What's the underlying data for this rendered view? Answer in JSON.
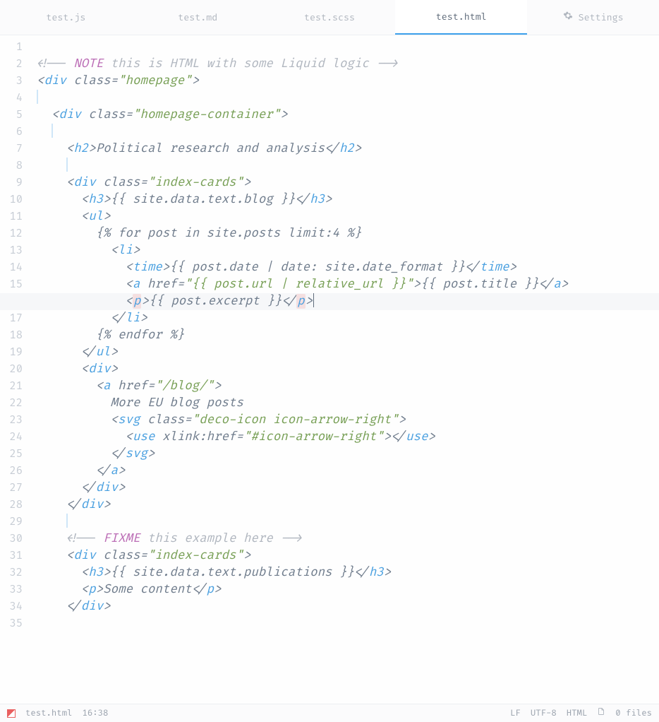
{
  "tabs": [
    {
      "label": "test.js",
      "active": false
    },
    {
      "label": "test.md",
      "active": false
    },
    {
      "label": "test.scss",
      "active": false
    },
    {
      "label": "test.html",
      "active": true
    },
    {
      "label": "Settings",
      "active": false,
      "icon": "gear"
    }
  ],
  "gutter": {
    "total": 35,
    "active_line": 16
  },
  "code_lines": [
    {
      "n": 1,
      "ind": 0,
      "tokens": []
    },
    {
      "n": 2,
      "ind": 0,
      "tokens": [
        [
          "cmnt",
          "<!-- "
        ],
        [
          "kw",
          "NOTE"
        ],
        [
          "cmnt",
          " this is HTML with some Liquid logic -->"
        ]
      ]
    },
    {
      "n": 3,
      "ind": 0,
      "tokens": [
        [
          "brkt",
          "<"
        ],
        [
          "tag",
          "div"
        ],
        [
          "txt",
          " "
        ],
        [
          "attr",
          "class"
        ],
        [
          "brkt",
          "="
        ],
        [
          "str",
          "\"homepage\""
        ],
        [
          "brkt",
          ">"
        ]
      ]
    },
    {
      "n": 4,
      "ind": 0,
      "tokens": [
        [
          "ig",
          ""
        ]
      ]
    },
    {
      "n": 5,
      "ind": 1,
      "tokens": [
        [
          "brkt",
          "<"
        ],
        [
          "tag",
          "div"
        ],
        [
          "txt",
          " "
        ],
        [
          "attr",
          "class"
        ],
        [
          "brkt",
          "="
        ],
        [
          "str",
          "\"homepage-container\""
        ],
        [
          "brkt",
          ">"
        ]
      ]
    },
    {
      "n": 6,
      "ind": 1,
      "tokens": [
        [
          "ig",
          ""
        ]
      ]
    },
    {
      "n": 7,
      "ind": 2,
      "tokens": [
        [
          "brkt",
          "<"
        ],
        [
          "tag",
          "h2"
        ],
        [
          "brkt",
          ">"
        ],
        [
          "txt",
          "Political research and analysis"
        ],
        [
          "brkt",
          "</"
        ],
        [
          "tag",
          "h2"
        ],
        [
          "brkt",
          ">"
        ]
      ]
    },
    {
      "n": 8,
      "ind": 2,
      "tokens": [
        [
          "ig",
          ""
        ]
      ]
    },
    {
      "n": 9,
      "ind": 2,
      "tokens": [
        [
          "brkt",
          "<"
        ],
        [
          "tag",
          "div"
        ],
        [
          "txt",
          " "
        ],
        [
          "attr",
          "class"
        ],
        [
          "brkt",
          "="
        ],
        [
          "str",
          "\"index-cards\""
        ],
        [
          "brkt",
          ">"
        ]
      ]
    },
    {
      "n": 10,
      "ind": 3,
      "tokens": [
        [
          "brkt",
          "<"
        ],
        [
          "tag",
          "h3"
        ],
        [
          "brkt",
          ">"
        ],
        [
          "liq",
          "{{ site.data.text.blog }}"
        ],
        [
          "brkt",
          "</"
        ],
        [
          "tag",
          "h3"
        ],
        [
          "brkt",
          ">"
        ]
      ]
    },
    {
      "n": 11,
      "ind": 3,
      "tokens": [
        [
          "brkt",
          "<"
        ],
        [
          "tag",
          "ul"
        ],
        [
          "brkt",
          ">"
        ]
      ]
    },
    {
      "n": 12,
      "ind": 4,
      "tokens": [
        [
          "liq",
          "{% for post in site.posts limit:4 %}"
        ]
      ]
    },
    {
      "n": 13,
      "ind": 5,
      "tokens": [
        [
          "brkt",
          "<"
        ],
        [
          "tag",
          "li"
        ],
        [
          "brkt",
          ">"
        ]
      ]
    },
    {
      "n": 14,
      "ind": 6,
      "tokens": [
        [
          "brkt",
          "<"
        ],
        [
          "tag",
          "time"
        ],
        [
          "brkt",
          ">"
        ],
        [
          "liq",
          "{{ post.date | date: site.date_format }}"
        ],
        [
          "brkt",
          "</"
        ],
        [
          "tag",
          "time"
        ],
        [
          "brkt",
          ">"
        ]
      ]
    },
    {
      "n": 15,
      "ind": 6,
      "tokens": [
        [
          "brkt",
          "<"
        ],
        [
          "tag",
          "a"
        ],
        [
          "txt",
          " "
        ],
        [
          "attr",
          "href"
        ],
        [
          "brkt",
          "="
        ],
        [
          "str",
          "\"{{ post.url | relative_url }}\""
        ],
        [
          "brkt",
          ">"
        ],
        [
          "liq",
          "{{ post.title }}"
        ],
        [
          "brkt",
          "</"
        ],
        [
          "tag",
          "a"
        ],
        [
          "brkt",
          ">"
        ]
      ]
    },
    {
      "n": 16,
      "ind": 6,
      "hl": true,
      "tokens": [
        [
          "brkt",
          "<"
        ],
        [
          "tag mark",
          "p"
        ],
        [
          "brkt",
          ">"
        ],
        [
          "liq",
          "{{ post.excerpt }}"
        ],
        [
          "brkt",
          "</"
        ],
        [
          "tag mark",
          "p"
        ],
        [
          "brkt",
          ">"
        ],
        [
          "cursor",
          ""
        ]
      ]
    },
    {
      "n": 17,
      "ind": 5,
      "tokens": [
        [
          "brkt",
          "</"
        ],
        [
          "tag",
          "li"
        ],
        [
          "brkt",
          ">"
        ]
      ]
    },
    {
      "n": 18,
      "ind": 4,
      "tokens": [
        [
          "liq",
          "{% endfor %}"
        ]
      ]
    },
    {
      "n": 19,
      "ind": 3,
      "tokens": [
        [
          "brkt",
          "</"
        ],
        [
          "tag",
          "ul"
        ],
        [
          "brkt",
          ">"
        ]
      ]
    },
    {
      "n": 20,
      "ind": 3,
      "tokens": [
        [
          "brkt",
          "<"
        ],
        [
          "tag",
          "div"
        ],
        [
          "brkt",
          ">"
        ]
      ]
    },
    {
      "n": 21,
      "ind": 4,
      "tokens": [
        [
          "brkt",
          "<"
        ],
        [
          "tag",
          "a"
        ],
        [
          "txt",
          " "
        ],
        [
          "attr",
          "href"
        ],
        [
          "brkt",
          "="
        ],
        [
          "str",
          "\"/blog/\""
        ],
        [
          "brkt",
          ">"
        ]
      ]
    },
    {
      "n": 22,
      "ind": 5,
      "tokens": [
        [
          "txt",
          "More EU blog posts"
        ]
      ]
    },
    {
      "n": 23,
      "ind": 5,
      "tokens": [
        [
          "brkt",
          "<"
        ],
        [
          "tag",
          "svg"
        ],
        [
          "txt",
          " "
        ],
        [
          "attr",
          "class"
        ],
        [
          "brkt",
          "="
        ],
        [
          "str",
          "\"deco-icon icon-arrow-right\""
        ],
        [
          "brkt",
          ">"
        ]
      ]
    },
    {
      "n": 24,
      "ind": 6,
      "tokens": [
        [
          "brkt",
          "<"
        ],
        [
          "tag",
          "use"
        ],
        [
          "txt",
          " "
        ],
        [
          "attr",
          "xlink:href"
        ],
        [
          "brkt",
          "="
        ],
        [
          "str",
          "\"#icon-arrow-right\""
        ],
        [
          "brkt",
          "></"
        ],
        [
          "tag",
          "use"
        ],
        [
          "brkt",
          ">"
        ]
      ]
    },
    {
      "n": 25,
      "ind": 5,
      "tokens": [
        [
          "brkt",
          "</"
        ],
        [
          "tag",
          "svg"
        ],
        [
          "brkt",
          ">"
        ]
      ]
    },
    {
      "n": 26,
      "ind": 4,
      "tokens": [
        [
          "brkt",
          "</"
        ],
        [
          "tag",
          "a"
        ],
        [
          "brkt",
          ">"
        ]
      ]
    },
    {
      "n": 27,
      "ind": 3,
      "tokens": [
        [
          "brkt",
          "</"
        ],
        [
          "tag",
          "div"
        ],
        [
          "brkt",
          ">"
        ]
      ]
    },
    {
      "n": 28,
      "ind": 2,
      "tokens": [
        [
          "brkt",
          "</"
        ],
        [
          "tag",
          "div"
        ],
        [
          "brkt",
          ">"
        ]
      ]
    },
    {
      "n": 29,
      "ind": 2,
      "tokens": [
        [
          "ig",
          ""
        ]
      ]
    },
    {
      "n": 30,
      "ind": 2,
      "tokens": [
        [
          "cmnt",
          "<!-- "
        ],
        [
          "kw",
          "FIXME"
        ],
        [
          "cmnt",
          " this example here -->"
        ]
      ]
    },
    {
      "n": 31,
      "ind": 2,
      "tokens": [
        [
          "brkt",
          "<"
        ],
        [
          "tag",
          "div"
        ],
        [
          "txt",
          " "
        ],
        [
          "attr",
          "class"
        ],
        [
          "brkt",
          "="
        ],
        [
          "str",
          "\"index-cards\""
        ],
        [
          "brkt",
          ">"
        ]
      ]
    },
    {
      "n": 32,
      "ind": 3,
      "tokens": [
        [
          "brkt",
          "<"
        ],
        [
          "tag",
          "h3"
        ],
        [
          "brkt",
          ">"
        ],
        [
          "liq",
          "{{ site.data.text.publications }}"
        ],
        [
          "brkt",
          "</"
        ],
        [
          "tag",
          "h3"
        ],
        [
          "brkt",
          ">"
        ]
      ]
    },
    {
      "n": 33,
      "ind": 3,
      "tokens": [
        [
          "brkt",
          "<"
        ],
        [
          "tag",
          "p"
        ],
        [
          "brkt",
          ">"
        ],
        [
          "txt",
          "Some content"
        ],
        [
          "brkt",
          "</"
        ],
        [
          "tag",
          "p"
        ],
        [
          "brkt",
          ">"
        ]
      ]
    },
    {
      "n": 34,
      "ind": 2,
      "tokens": [
        [
          "brkt",
          "</"
        ],
        [
          "tag",
          "div"
        ],
        [
          "brkt",
          ">"
        ]
      ]
    },
    {
      "n": 35,
      "ind": 0,
      "tokens": []
    }
  ],
  "status": {
    "file": "test.html",
    "time": "16:38",
    "eol": "LF",
    "encoding": "UTF-8",
    "mode": "HTML",
    "files": "0 files"
  }
}
